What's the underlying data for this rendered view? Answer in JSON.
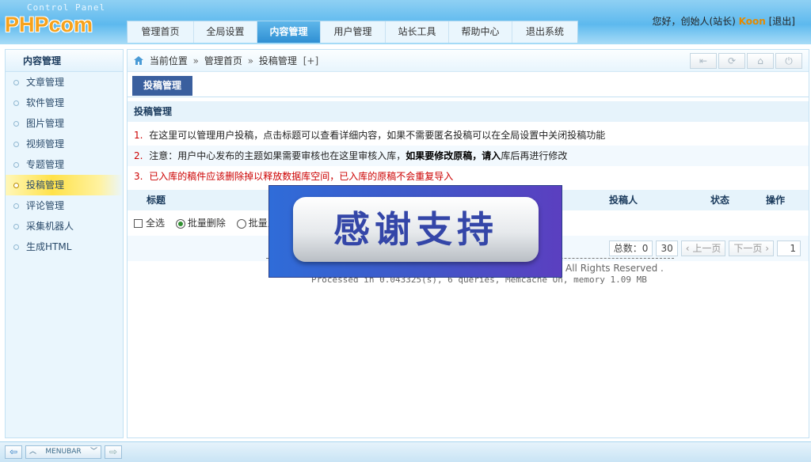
{
  "header": {
    "logo_sub": "Control Panel",
    "logo": "PHPcom",
    "nav": [
      {
        "label": "管理首页",
        "active": false
      },
      {
        "label": "全局设置",
        "active": false
      },
      {
        "label": "内容管理",
        "active": true
      },
      {
        "label": "用户管理",
        "active": false
      },
      {
        "label": "站长工具",
        "active": false
      },
      {
        "label": "帮助中心",
        "active": false
      },
      {
        "label": "退出系统",
        "active": false
      }
    ],
    "greeting": "您好，创始人(站长)",
    "username": "Koon",
    "logout": "[退出]"
  },
  "sidebar": {
    "title": "内容管理",
    "items": [
      {
        "label": "文章管理"
      },
      {
        "label": "软件管理"
      },
      {
        "label": "图片管理"
      },
      {
        "label": "视频管理"
      },
      {
        "label": "专题管理"
      },
      {
        "label": "投稿管理"
      },
      {
        "label": "评论管理"
      },
      {
        "label": "采集机器人"
      },
      {
        "label": "生成HTML"
      }
    ]
  },
  "breadcrumb": {
    "prefix": "当前位置",
    "sep": "»",
    "home": "管理首页",
    "current": "投稿管理",
    "add": "[+]"
  },
  "toolbar": {
    "back": "⇤",
    "refresh": "⟳",
    "home": "⌂",
    "power": "⏻"
  },
  "subtab": "投稿管理",
  "section_title": "投稿管理",
  "notes": {
    "n1": {
      "num": "1.",
      "text": "在这里可以管理用户投稿，点击标题可以查看详细内容，如果不需要匿名投稿可以在全局设置中关闭投稿功能"
    },
    "n2": {
      "num": "2.",
      "a": "注意：用户中心发布的主题如果需要审核也在这里审核入库，",
      "b": "如果要修改原稿，请入",
      "c": "库后再进行修改"
    },
    "n3": {
      "num": "3.",
      "text": "已入库的稿件应该删除掉以释放数据库空间，已入库的原稿不会重复导入"
    }
  },
  "table": {
    "headers": {
      "title": "标题",
      "author": "投稿人",
      "status": "状态",
      "action": "操作"
    }
  },
  "options": {
    "select_all": "全选",
    "batch_delete": "批量删除",
    "batch_import": "批量入"
  },
  "pager": {
    "total_label": "总数：0",
    "per_page": "30",
    "prev": "上一页",
    "next": "下一页",
    "page": "1"
  },
  "footer": {
    "rights": "All Rights Reserved .",
    "processed": "Processed in 0.043325(s), 6 queries, Memcache On, memory 1.09 MB"
  },
  "overlay_text": "感谢支持",
  "bottombar": {
    "label": "MENUBAR"
  }
}
